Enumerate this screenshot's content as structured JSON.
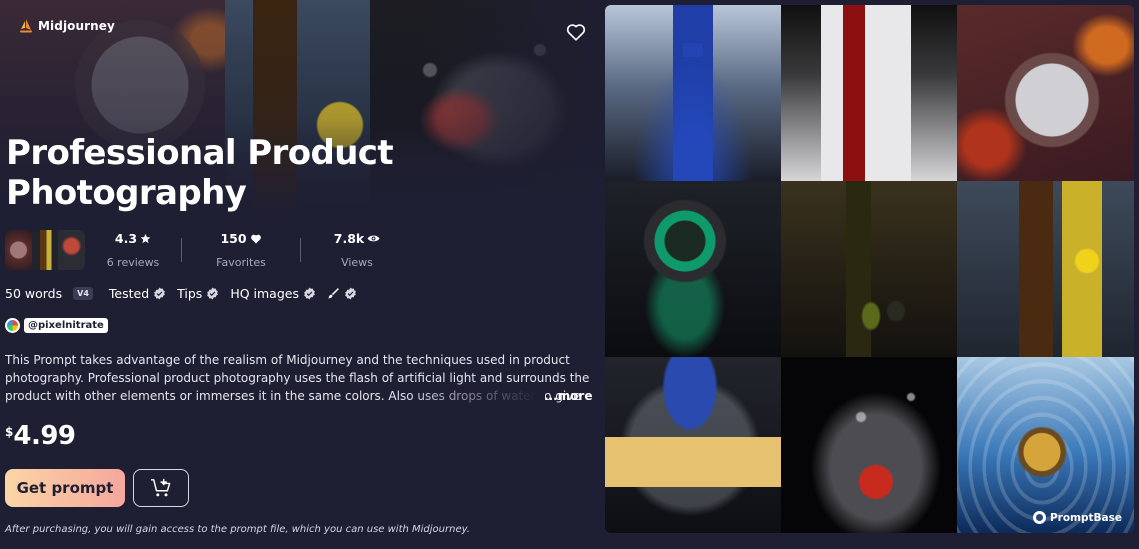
{
  "brand": {
    "name": "Midjourney",
    "icon": "midjourney-sail-icon"
  },
  "favorite": {
    "icon": "heart-outline-icon"
  },
  "title": "Professional Product Photography",
  "stats": [
    {
      "value": "4.3",
      "icon": "star-icon",
      "label": "6 reviews"
    },
    {
      "value": "150",
      "icon": "heart-icon",
      "label": "Favorites"
    },
    {
      "value": "7.8k",
      "icon": "eye-icon",
      "label": "Views"
    }
  ],
  "features": {
    "words": "50 words",
    "version": "V4",
    "tested": "Tested",
    "tips": "Tips",
    "hq": "HQ images",
    "edit_icon": "brush-icon",
    "verified_icon": "verified-check-icon"
  },
  "author": {
    "handle": "@pixelnitrate"
  },
  "description": "This Prompt takes advantage of the realism of Midjourney and the techniques used in product photography. Professional product photography uses the flash of artificial light and surrounds the product with other elements or immerses it in the same colors. Also uses drops of water to give",
  "more_label": "...more",
  "price": {
    "currency": "$",
    "value": "4.99"
  },
  "buttons": {
    "get_prompt": "Get prompt",
    "cart_icon": "add-to-cart-icon"
  },
  "note": "After purchasing, you will gain access to the prompt file, which you can use with Midjourney.",
  "gallery": {
    "images": [
      "blue perfume bottle",
      "red wine bottle in white box",
      "luxury watch with autumn leaves",
      "emerald ring",
      "olive oil bottle with olives",
      "beer bottle with lemonade",
      "cheese under glass dome",
      "strawberry water splash",
      "gold ring in water ripples"
    ],
    "watermark": "PromptBase"
  }
}
